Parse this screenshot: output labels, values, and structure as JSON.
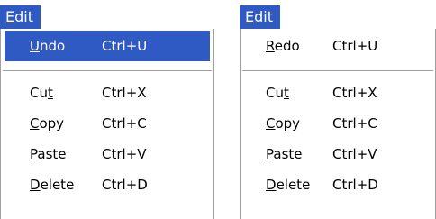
{
  "colors": {
    "menu_highlight": "#2f59c3",
    "highlight_text": "#ffffff",
    "separator": "#a0a0a0"
  },
  "left_menu": {
    "title": {
      "mnemonic": "E",
      "rest": "dit"
    },
    "items": [
      {
        "mnemonic": "U",
        "rest": "ndo",
        "before": "",
        "shortcut": "Ctrl+U",
        "highlighted": true
      },
      {
        "before": "Cu",
        "mnemonic": "t",
        "rest": "",
        "shortcut": "Ctrl+X"
      },
      {
        "before": "",
        "mnemonic": "C",
        "rest": "opy",
        "shortcut": "Ctrl+C"
      },
      {
        "before": "",
        "mnemonic": "P",
        "rest": "aste",
        "shortcut": "Ctrl+V"
      },
      {
        "before": "",
        "mnemonic": "D",
        "rest": "elete",
        "shortcut": "Ctrl+D"
      }
    ]
  },
  "right_menu": {
    "title": {
      "mnemonic": "E",
      "rest": "dit"
    },
    "items": [
      {
        "before": "",
        "mnemonic": "R",
        "rest": "edo",
        "shortcut": "Ctrl+U"
      },
      {
        "before": "Cu",
        "mnemonic": "t",
        "rest": "",
        "shortcut": "Ctrl+X"
      },
      {
        "before": "",
        "mnemonic": "C",
        "rest": "opy",
        "shortcut": "Ctrl+C"
      },
      {
        "before": "",
        "mnemonic": "P",
        "rest": "aste",
        "shortcut": "Ctrl+V"
      },
      {
        "before": "",
        "mnemonic": "D",
        "rest": "elete",
        "shortcut": "Ctrl+D"
      }
    ]
  }
}
